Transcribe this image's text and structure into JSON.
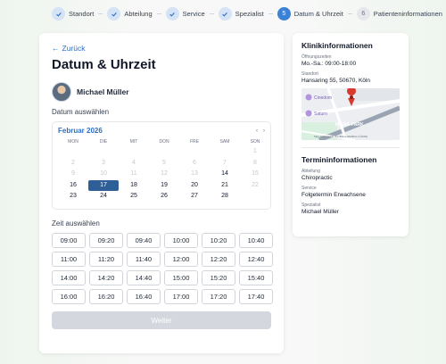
{
  "stepper": [
    {
      "label": "Standort",
      "state": "done",
      "num": ""
    },
    {
      "label": "Abteilung",
      "state": "done",
      "num": ""
    },
    {
      "label": "Service",
      "state": "done",
      "num": ""
    },
    {
      "label": "Spezialist",
      "state": "done",
      "num": ""
    },
    {
      "label": "Datum & Uhrzeit",
      "state": "active",
      "num": "5"
    },
    {
      "label": "Patienteninformationen",
      "state": "todo",
      "num": "6"
    }
  ],
  "main": {
    "back_label": "Zurück",
    "title": "Datum & Uhrzeit",
    "doctor_name": "Michael Müller",
    "date_label": "Datum auswählen",
    "time_label": "Zeit auswählen",
    "weiter_label": "Weiter"
  },
  "calendar": {
    "month": "Februar 2026",
    "prev_icon": "‹",
    "next_icon": "›",
    "dow": [
      "MON",
      "DIE",
      "MIT",
      "DON",
      "FRE",
      "SAM",
      "SON"
    ],
    "weeks": [
      [
        {
          "d": "",
          "s": "empty"
        },
        {
          "d": "",
          "s": "empty"
        },
        {
          "d": "",
          "s": "empty"
        },
        {
          "d": "",
          "s": "empty"
        },
        {
          "d": "",
          "s": "empty"
        },
        {
          "d": "",
          "s": "empty"
        },
        {
          "d": "1",
          "s": "muted"
        }
      ],
      [
        {
          "d": "2",
          "s": "muted"
        },
        {
          "d": "3",
          "s": "muted"
        },
        {
          "d": "4",
          "s": "muted"
        },
        {
          "d": "5",
          "s": "muted"
        },
        {
          "d": "6",
          "s": "muted"
        },
        {
          "d": "7",
          "s": "muted"
        },
        {
          "d": "8",
          "s": "muted"
        }
      ],
      [
        {
          "d": "9",
          "s": "muted"
        },
        {
          "d": "10",
          "s": "muted"
        },
        {
          "d": "11",
          "s": "muted"
        },
        {
          "d": "12",
          "s": "muted"
        },
        {
          "d": "13",
          "s": "muted"
        },
        {
          "d": "14",
          "s": "normal"
        },
        {
          "d": "15",
          "s": "muted"
        }
      ],
      [
        {
          "d": "16",
          "s": "normal"
        },
        {
          "d": "17",
          "s": "selected"
        },
        {
          "d": "18",
          "s": "normal"
        },
        {
          "d": "19",
          "s": "normal"
        },
        {
          "d": "20",
          "s": "normal"
        },
        {
          "d": "21",
          "s": "normal"
        },
        {
          "d": "22",
          "s": "muted"
        }
      ],
      [
        {
          "d": "23",
          "s": "normal"
        },
        {
          "d": "24",
          "s": "normal"
        },
        {
          "d": "25",
          "s": "normal"
        },
        {
          "d": "26",
          "s": "normal"
        },
        {
          "d": "27",
          "s": "normal"
        },
        {
          "d": "28",
          "s": "normal"
        },
        {
          "d": "",
          "s": "empty"
        }
      ]
    ]
  },
  "times": [
    "09:00",
    "09:20",
    "09:40",
    "10:00",
    "10:20",
    "10:40",
    "11:00",
    "11:20",
    "11:40",
    "12:00",
    "12:20",
    "12:40",
    "14:00",
    "14:20",
    "14:40",
    "15:00",
    "15:20",
    "15:40",
    "16:00",
    "16:20",
    "16:40",
    "17:00",
    "17:20",
    "17:40"
  ],
  "clinic": {
    "title": "Klinikinformationen",
    "hours_label": "Öffnungszeiten",
    "hours_value": "Mo.-Sa.: 09:00-18:00",
    "location_label": "Standort",
    "location_value": "Hansaring 55, 50670, Köln",
    "map_labels": {
      "top": "Cinedom",
      "middle": "Saturn",
      "mediapark": "MEDIA-PARK",
      "attribution": "Map data ©2026 GeoBasis-DE/BKG (©2009)"
    }
  },
  "termin": {
    "title": "Termininformationen",
    "dept_label": "Abteilung",
    "dept_value": "Chiropractic",
    "service_label": "Service",
    "service_value": "Folgetermin Erwachsene",
    "spec_label": "Spezialist",
    "spec_value": "Michael Müller"
  },
  "colors": {
    "accent": "#3b82d6",
    "selected_day": "#2f5f97",
    "link": "#2f6fbf"
  }
}
